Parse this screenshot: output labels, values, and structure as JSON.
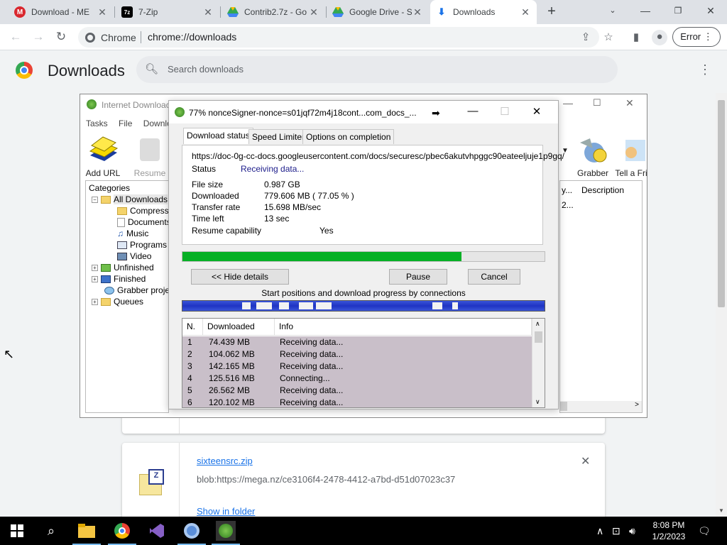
{
  "browser": {
    "tabs": [
      {
        "title": "Download - ME",
        "icon": "mega-icon"
      },
      {
        "title": "7-Zip",
        "icon": "7zip-icon"
      },
      {
        "title": "Contrib2.7z - Go",
        "icon": "drive-icon"
      },
      {
        "title": "Google Drive - S",
        "icon": "drive-icon"
      },
      {
        "title": "Downloads",
        "icon": "download-icon"
      }
    ],
    "omnibox_chip": "Chrome",
    "url": "chrome://downloads",
    "error_label": "Error"
  },
  "downloads_page": {
    "title": "Downloads",
    "search_placeholder": "Search downloads",
    "item": {
      "filename": "sixteensrc.zip",
      "url": "blob:https://mega.nz/ce3106f4-2478-4412-a7bd-d51d07023c37",
      "show_in_folder": "Show in folder"
    }
  },
  "idm_main": {
    "title": "Internet Downloac",
    "menu": [
      "Tasks",
      "File",
      "Downlo"
    ],
    "toolbar": [
      {
        "label": "Add URL",
        "icon": "add-url-icon"
      },
      {
        "label": "Resume",
        "icon": "resume-icon"
      },
      {
        "label": "Grabber",
        "icon": "grabber-icon"
      },
      {
        "label": "Tell a Fri",
        "icon": "tell-friend-icon"
      }
    ],
    "categories_header": "Categories",
    "categories": [
      {
        "label": "All Downloads"
      },
      {
        "label": "Compresse"
      },
      {
        "label": "Documents"
      },
      {
        "label": "Music"
      },
      {
        "label": "Programs"
      },
      {
        "label": "Video"
      },
      {
        "label": "Unfinished"
      },
      {
        "label": "Finished"
      },
      {
        "label": "Grabber projec"
      },
      {
        "label": "Queues"
      }
    ],
    "list_columns": [
      "y...",
      "Description"
    ],
    "list_cell": "2..."
  },
  "dialog": {
    "title": "77% nonceSigner-nonce=s01jqf72m4j18cont...com_docs_...",
    "tabs": [
      "Download status",
      "Speed Limiter",
      "Options on completion"
    ],
    "url": "https://doc-0g-cc-docs.googleusercontent.com/docs/securesc/pbec6akutvhpggc90eateeljuje1p9gq/",
    "status_label": "Status",
    "status_value": "Receiving data...",
    "file_size_label": "File size",
    "file_size_value": "0.987  GB",
    "downloaded_label": "Downloaded",
    "downloaded_value": "779.606  MB  ( 77.05 % )",
    "transfer_rate_label": "Transfer rate",
    "transfer_rate_value": "15.698  MB/sec",
    "time_left_label": "Time left",
    "time_left_value": "13 sec",
    "resume_label": "Resume capability",
    "resume_value": "Yes",
    "progress": 0.7705,
    "hide_details": "<< Hide details",
    "pause": "Pause",
    "cancel": "Cancel",
    "connections_caption": "Start positions and download progress by connections",
    "table_headers": [
      "N.",
      "Downloaded",
      "Info"
    ],
    "connections": [
      {
        "n": "1",
        "downloaded": "74.439  MB",
        "info": "Receiving data..."
      },
      {
        "n": "2",
        "downloaded": "104.062  MB",
        "info": "Receiving data..."
      },
      {
        "n": "3",
        "downloaded": "142.165  MB",
        "info": "Receiving data..."
      },
      {
        "n": "4",
        "downloaded": "125.516  MB",
        "info": "Connecting..."
      },
      {
        "n": "5",
        "downloaded": "26.562  MB",
        "info": "Receiving data..."
      },
      {
        "n": "6",
        "downloaded": "120.102  MB",
        "info": "Receiving data..."
      }
    ]
  },
  "taskbar": {
    "time": "8:08 PM",
    "date": "1/2/2023"
  },
  "colors": {
    "progress_fill": "#06b025",
    "connection_row": "#c9bfc9",
    "link": "#1a73e8"
  }
}
